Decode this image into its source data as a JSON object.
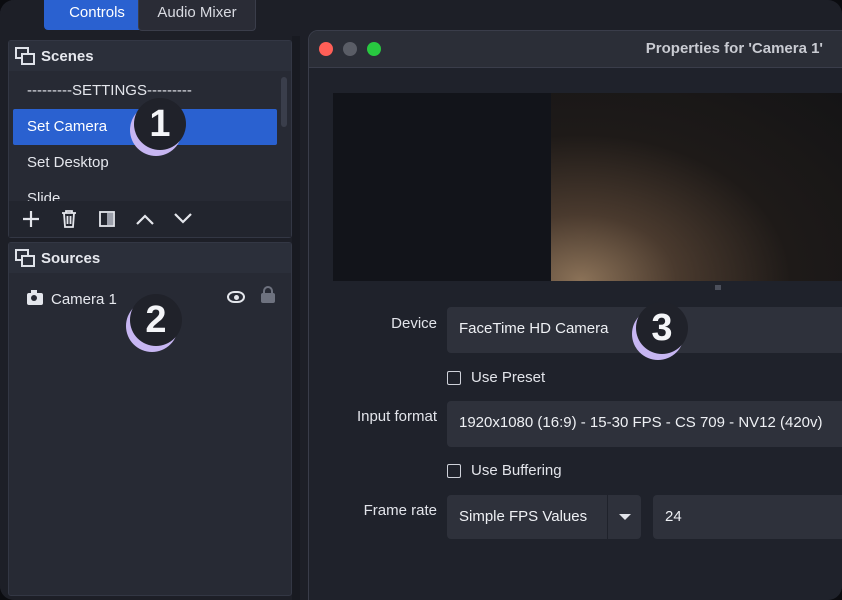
{
  "tabs": {
    "controls": "Controls",
    "audio_mixer": "Audio Mixer"
  },
  "scenes": {
    "title": "Scenes",
    "items": [
      "---------SETTINGS---------",
      "Set Camera",
      "Set Desktop",
      "Slide"
    ],
    "selected": "Set Camera"
  },
  "sources": {
    "title": "Sources",
    "items": [
      {
        "label": "Camera 1"
      }
    ]
  },
  "annotations": [
    "1",
    "2",
    "3"
  ],
  "properties": {
    "window_title": "Properties for 'Camera 1'",
    "device_label": "Device",
    "device_value": "FaceTime HD Camera",
    "use_preset_label": "Use Preset",
    "use_preset_checked": false,
    "input_format_label": "Input format",
    "input_format_value": "1920x1080 (16:9) - 15-30 FPS - CS 709 - NV12 (420v)",
    "use_buffering_label": "Use Buffering",
    "use_buffering_checked": false,
    "frame_rate_label": "Frame rate",
    "frame_rate_mode": "Simple FPS Values",
    "frame_rate_value": "24"
  },
  "colors": {
    "accent": "#2a61d0",
    "annotation_shadow": "#c7b6f2",
    "close": "#ff5f57",
    "maximize": "#28c840"
  }
}
